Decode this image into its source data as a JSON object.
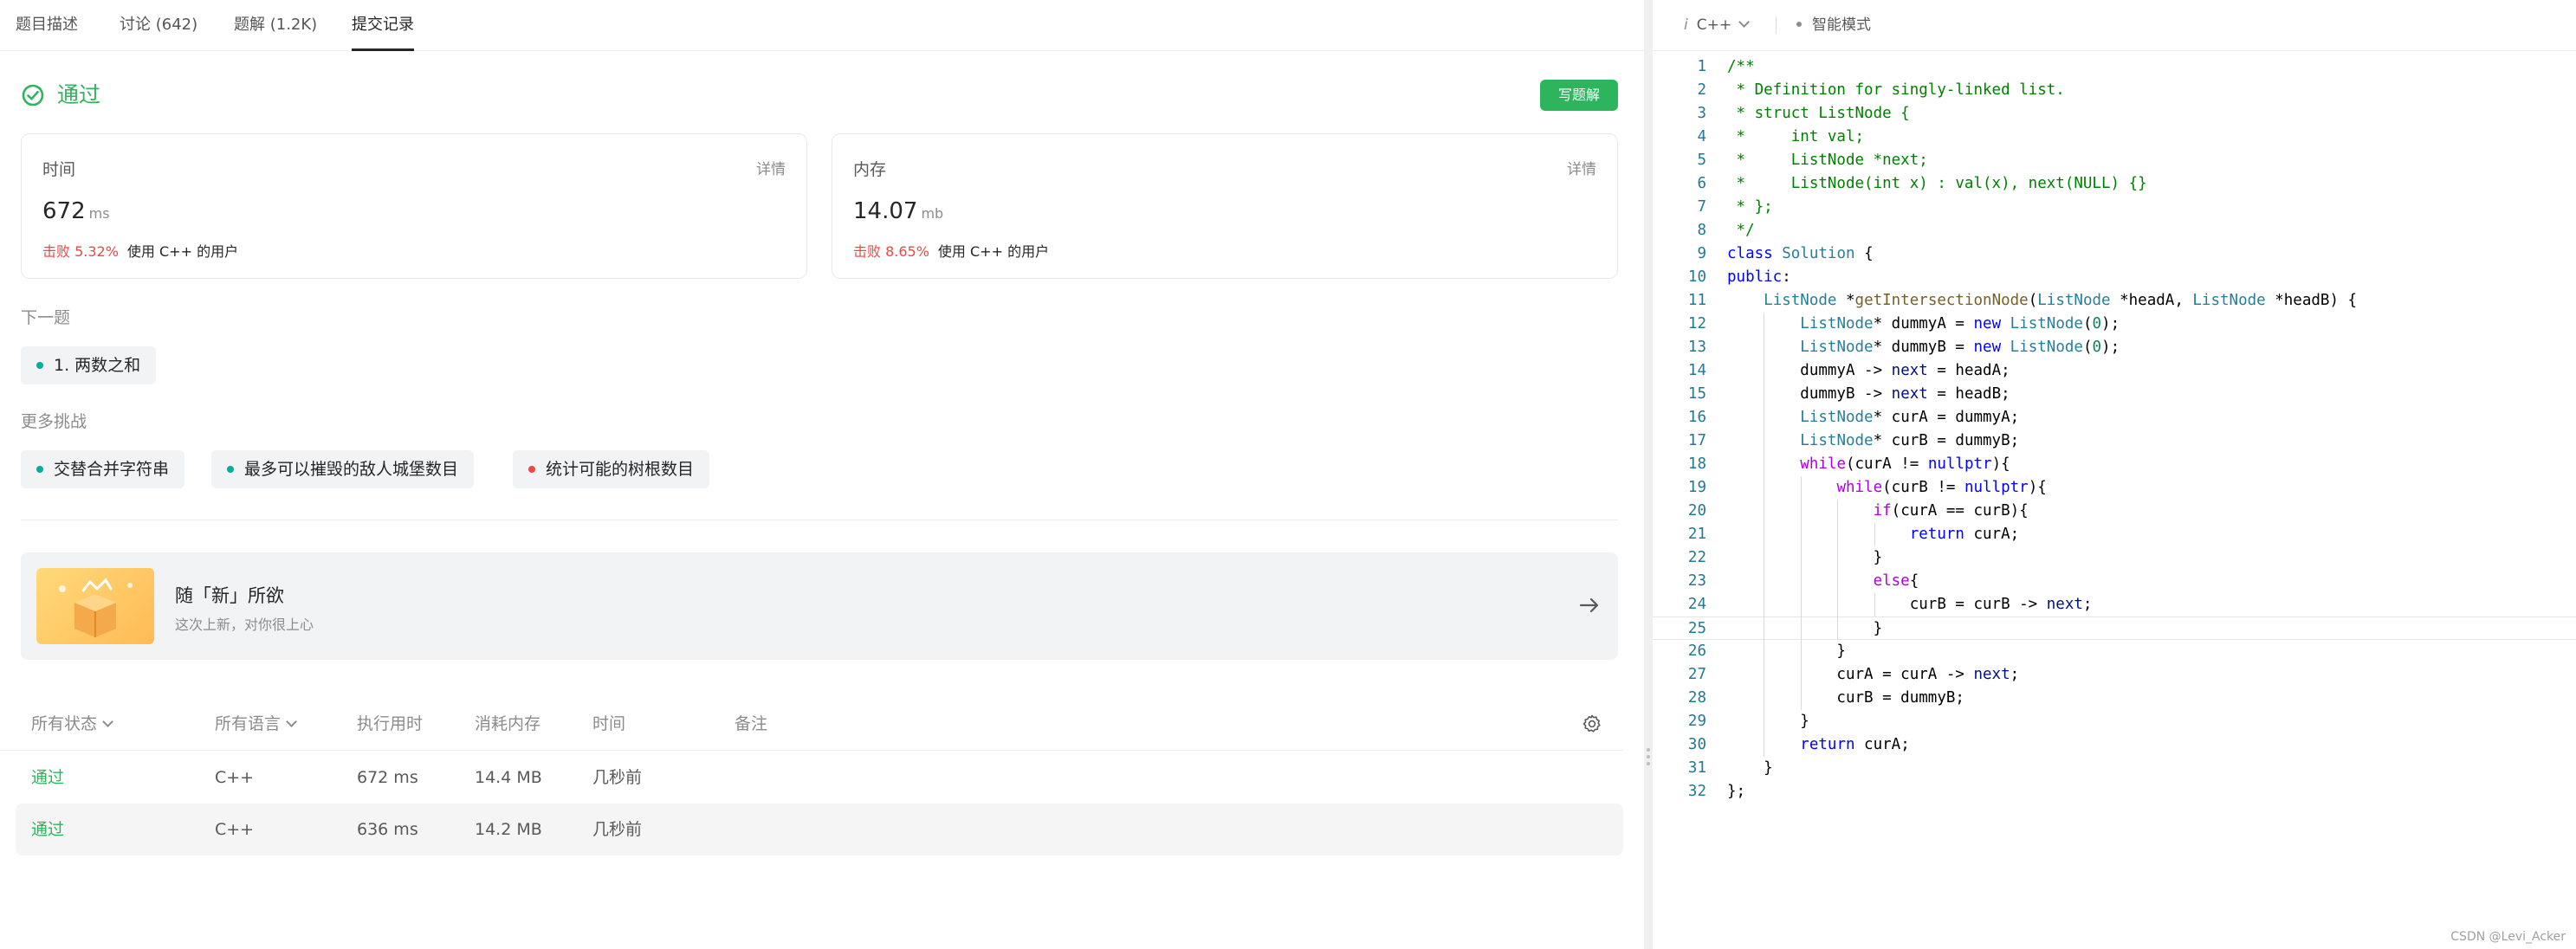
{
  "tabs": [
    {
      "label": "题目描述",
      "active": false
    },
    {
      "label": "讨论 (642)",
      "active": false
    },
    {
      "label": "题解 (1.2K)",
      "active": false
    },
    {
      "label": "提交记录",
      "active": true
    }
  ],
  "result": {
    "status": "通过",
    "write_solution_label": "写题解",
    "accent_color": "#2db55d"
  },
  "runtime_card": {
    "title": "时间",
    "detail_label": "详情",
    "value": "672",
    "unit": "ms",
    "beat_text": "击败 5.32%",
    "users_text": "使用 C++ 的用户"
  },
  "memory_card": {
    "title": "内存",
    "detail_label": "详情",
    "value": "14.07",
    "unit": "mb",
    "beat_text": "击败 8.65%",
    "users_text": "使用 C++ 的用户"
  },
  "next_problem": {
    "label": "下一题",
    "item": {
      "text": "1. 两数之和",
      "dot_color": "#00af9b"
    }
  },
  "more_challenges": {
    "label": "更多挑战",
    "items": [
      {
        "text": "交替合并字符串",
        "dot_color": "#00af9b"
      },
      {
        "text": "最多可以摧毁的敌人城堡数目",
        "dot_color": "#00af9b"
      },
      {
        "text": "统计可能的树根数目",
        "dot_color": "#ef4743"
      }
    ]
  },
  "promo": {
    "title": "随「新」所欲",
    "subtitle": "这次上新，对你很上心"
  },
  "submissions": {
    "headers": {
      "status": "所有状态",
      "language": "所有语言",
      "runtime": "执行用时",
      "memory": "消耗内存",
      "time": "时间",
      "notes": "备注"
    },
    "rows": [
      {
        "status": "通过",
        "language": "C++",
        "runtime": "672 ms",
        "memory": "14.4 MB",
        "time": "几秒前"
      },
      {
        "status": "通过",
        "language": "C++",
        "runtime": "636 ms",
        "memory": "14.2 MB",
        "time": "几秒前"
      }
    ]
  },
  "editor": {
    "language": "C++",
    "info_glyph": "i",
    "mode_label": "智能模式",
    "current_line": 25
  },
  "code_lines": [
    "/**",
    " * Definition for singly-linked list.",
    " * struct ListNode {",
    " *     int val;",
    " *     ListNode *next;",
    " *     ListNode(int x) : val(x), next(NULL) {}",
    " * };",
    " */",
    "class Solution {",
    "public:",
    "    ListNode *getIntersectionNode(ListNode *headA, ListNode *headB) {",
    "        ListNode* dummyA = new ListNode(0);",
    "        ListNode* dummyB = new ListNode(0);",
    "        dummyA -> next = headA;",
    "        dummyB -> next = headB;",
    "        ListNode* curA = dummyA;",
    "        ListNode* curB = dummyB;",
    "        while(curA != nullptr){",
    "            while(curB != nullptr){",
    "                if(curA == curB){",
    "                    return curA;",
    "                }",
    "                else{",
    "                    curB = curB -> next;",
    "                }",
    "            }",
    "            curA = curA -> next;",
    "            curB = dummyB;",
    "        }",
    "        return curA;",
    "    }",
    "};"
  ],
  "watermark": "CSDN @Levi_Acker"
}
